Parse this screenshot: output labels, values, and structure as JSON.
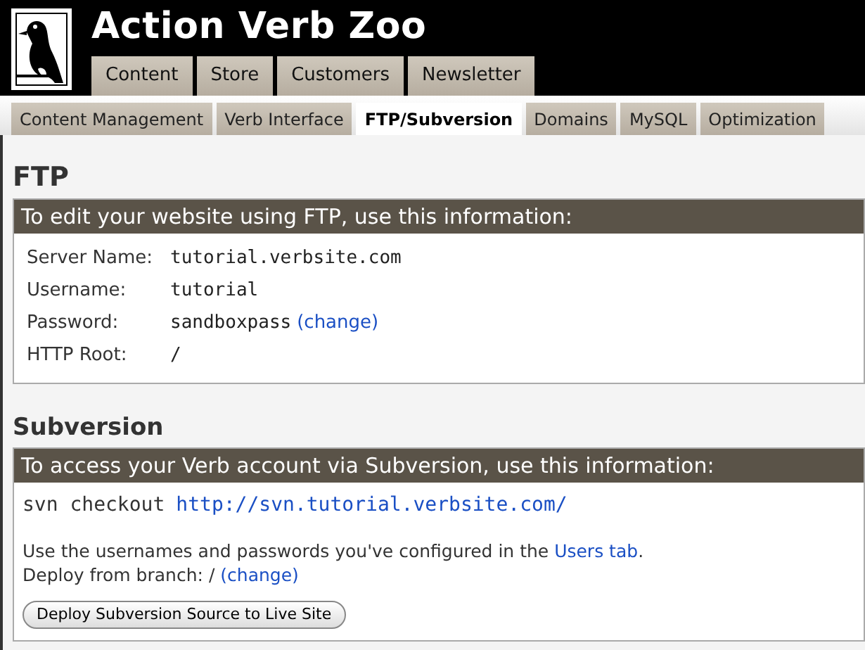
{
  "site": {
    "title": "Action Verb Zoo"
  },
  "main_tabs": [
    {
      "label": "Content",
      "selected": false
    },
    {
      "label": "Store",
      "selected": false
    },
    {
      "label": "Customers",
      "selected": false
    },
    {
      "label": "Newsletter",
      "selected": false
    }
  ],
  "sub_tabs": [
    {
      "label": "Content Management",
      "selected": false
    },
    {
      "label": "Verb Interface",
      "selected": false
    },
    {
      "label": "FTP/Subversion",
      "selected": true
    },
    {
      "label": "Domains",
      "selected": false
    },
    {
      "label": "MySQL",
      "selected": false
    },
    {
      "label": "Optimization",
      "selected": false
    }
  ],
  "ftp": {
    "heading": "FTP",
    "bar": "To edit your website using FTP, use this information:",
    "rows": [
      {
        "label": "Server Name:",
        "value": "tutorial.verbsite.com"
      },
      {
        "label": "Username:",
        "value": "tutorial"
      },
      {
        "label": "Password:",
        "value": "sandboxpass",
        "link": "(change)"
      },
      {
        "label": "HTTP Root:",
        "value": "/"
      }
    ]
  },
  "subversion": {
    "heading": "Subversion",
    "bar": "To access your Verb account via Subversion, use this information:",
    "command": "svn checkout",
    "url": "http://svn.tutorial.verbsite.com/",
    "note": {
      "before": "Use the usernames and passwords you've configured in the ",
      "link": "Users tab",
      "after": "."
    },
    "branch": {
      "text": "Deploy from branch: /",
      "link": "(change)"
    },
    "button": "Deploy Subversion Source to Live Site"
  }
}
